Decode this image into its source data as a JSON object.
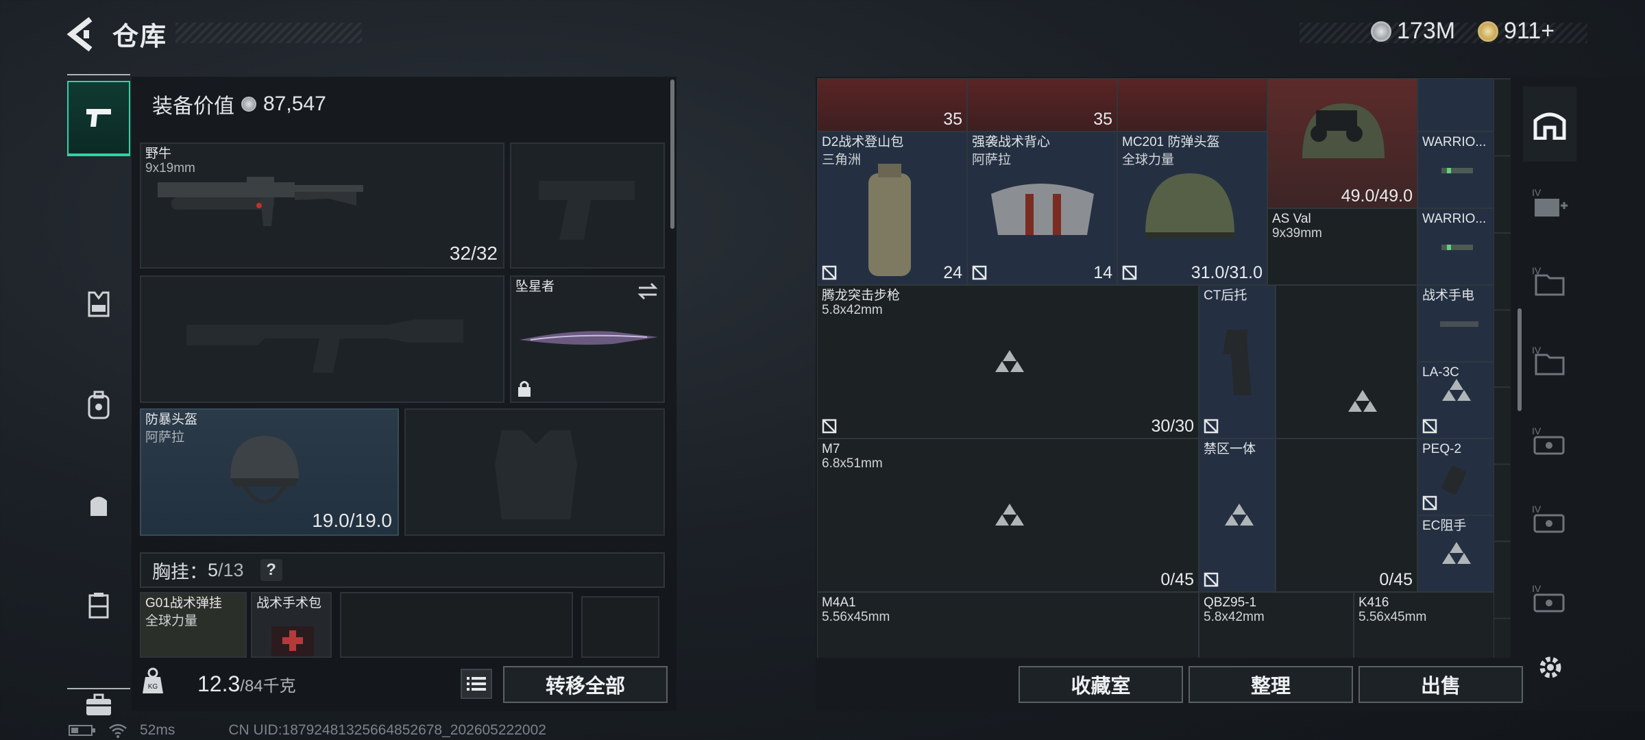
{
  "header": {
    "title": "仓库",
    "currency_1": "173M",
    "currency_2": "911+"
  },
  "categories": [
    {
      "icon": "pistol-icon",
      "active": true
    },
    {
      "icon": "armor-vest-icon",
      "active": false
    },
    {
      "icon": "backpack-icon",
      "active": false
    },
    {
      "icon": "bag-icon",
      "active": false
    },
    {
      "icon": "container-icon",
      "active": false
    },
    {
      "icon": "toolbox-icon",
      "active": false
    }
  ],
  "loadout": {
    "equip_value_label": "装备价值",
    "equip_value": "87,547",
    "primary": {
      "name": "野牛",
      "caliber": "9x19mm",
      "ammo": "32/32"
    },
    "melee": {
      "name": "坠星者"
    },
    "helmet": {
      "name": "防暴头盔",
      "brand": "阿萨拉",
      "durability": "19.0/19.0"
    },
    "chest_rig_label": "胸挂：",
    "chest_rig_count": "5",
    "chest_rig_total": "/13",
    "chest_help": "?",
    "rig_items": [
      {
        "name": "G01战术弹挂",
        "brand": "全球力量"
      },
      {
        "name": "战术手术包"
      }
    ],
    "weight": "12.3",
    "weight_max": "/84千克",
    "transfer_all": "转移全部"
  },
  "storage": {
    "top_row": [
      {
        "count": "35"
      },
      {
        "count": "35"
      }
    ],
    "items": [
      {
        "key": "d2",
        "name": "D2战术登山包",
        "brand": "三角洲",
        "value": "24"
      },
      {
        "key": "vest",
        "name": "强袭战术背心",
        "brand": "阿萨拉",
        "value": "14"
      },
      {
        "key": "mc201",
        "name": "MC201 防弹头盔",
        "brand": "全球力量",
        "value": "31.0/31.0"
      },
      {
        "key": "nvg",
        "value": "49.0/49.0"
      },
      {
        "key": "asval",
        "name": "AS Val",
        "caliber": "9x39mm"
      },
      {
        "key": "warrior1",
        "name": "WARRIO..."
      },
      {
        "key": "warrior2",
        "name": "WARRIO..."
      },
      {
        "key": "tenglong",
        "name": "腾龙突击步枪",
        "caliber": "5.8x42mm",
        "value": "30/30"
      },
      {
        "key": "ct",
        "name": "CT后托"
      },
      {
        "key": "flashlight",
        "name": "战术手电"
      },
      {
        "key": "la3c",
        "name": "LA-3C"
      },
      {
        "key": "m7",
        "name": "M7",
        "caliber": "6.8x51mm",
        "value": "0/45"
      },
      {
        "key": "jinqu",
        "name": "禁区一体"
      },
      {
        "key": "peq2",
        "name": "PEQ-2"
      },
      {
        "key": "ec",
        "name": "EC阻手"
      },
      {
        "key": "asval_ammo",
        "value": "0/45"
      },
      {
        "key": "m4a1",
        "name": "M4A1",
        "caliber": "5.56x45mm"
      },
      {
        "key": "qbz",
        "name": "QBZ95-1",
        "caliber": "5.8x42mm"
      },
      {
        "key": "k416",
        "name": "K416",
        "caliber": "5.56x45mm"
      }
    ],
    "buttons": {
      "collection": "收藏室",
      "sort": "整理",
      "sell": "出售"
    }
  },
  "right_tabs": [
    "armory-icon",
    "medkit-tab-icon",
    "folder-tab-icon",
    "folder-tab-icon",
    "case-tab-icon",
    "case-tab-icon",
    "case-tab-icon"
  ],
  "status": {
    "ping": "52ms",
    "uid": "CN UID:18792481325664852678_202605222002"
  },
  "colors": {
    "accent": "#2fd3a6",
    "highlight_red": "#5a2424",
    "highlight_blue": "#273446"
  }
}
